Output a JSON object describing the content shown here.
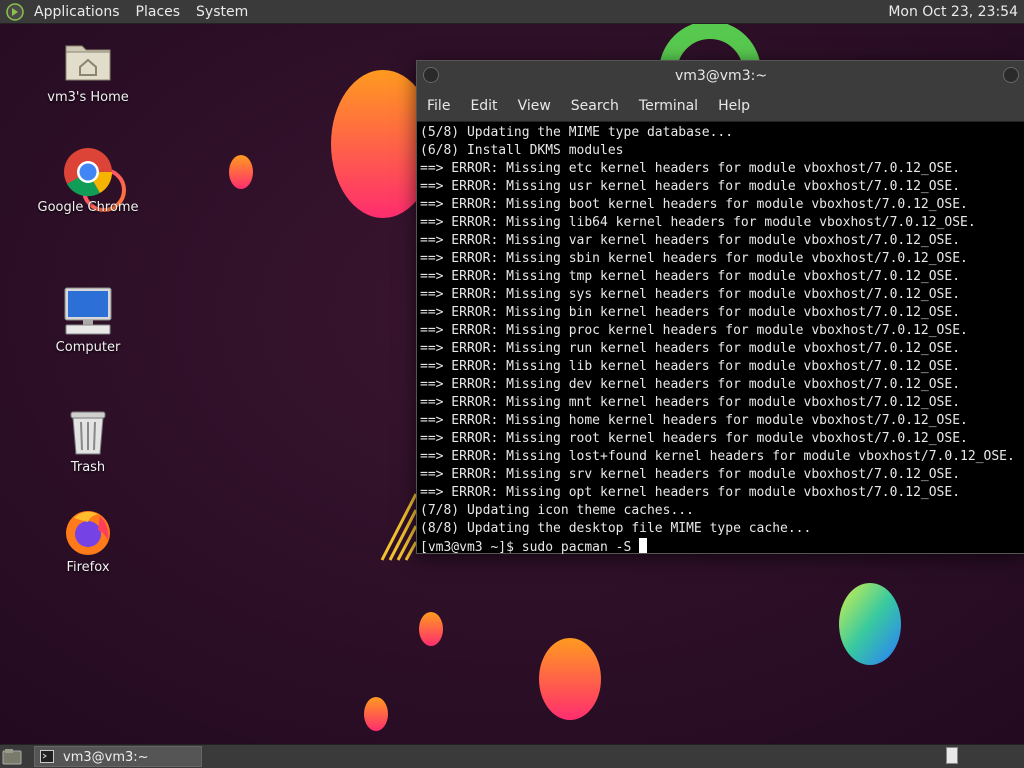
{
  "top_panel": {
    "menus": [
      "Applications",
      "Places",
      "System"
    ],
    "clock": "Mon Oct 23, 23:54"
  },
  "desktop_icons": [
    {
      "label": "vm3's Home",
      "icon": "home-folder-icon"
    },
    {
      "label": "Google Chrome",
      "icon": "chrome-icon"
    },
    {
      "label": "Computer",
      "icon": "computer-icon"
    },
    {
      "label": "Trash",
      "icon": "trash-icon"
    },
    {
      "label": "Firefox",
      "icon": "firefox-icon"
    }
  ],
  "terminal": {
    "title": "vm3@vm3:~",
    "menus": [
      "File",
      "Edit",
      "View",
      "Search",
      "Terminal",
      "Help"
    ],
    "lines": [
      "(5/8) Updating the MIME type database...",
      "(6/8) Install DKMS modules",
      "==> ERROR: Missing etc kernel headers for module vboxhost/7.0.12_OSE.",
      "==> ERROR: Missing usr kernel headers for module vboxhost/7.0.12_OSE.",
      "==> ERROR: Missing boot kernel headers for module vboxhost/7.0.12_OSE.",
      "==> ERROR: Missing lib64 kernel headers for module vboxhost/7.0.12_OSE.",
      "==> ERROR: Missing var kernel headers for module vboxhost/7.0.12_OSE.",
      "==> ERROR: Missing sbin kernel headers for module vboxhost/7.0.12_OSE.",
      "==> ERROR: Missing tmp kernel headers for module vboxhost/7.0.12_OSE.",
      "==> ERROR: Missing sys kernel headers for module vboxhost/7.0.12_OSE.",
      "==> ERROR: Missing bin kernel headers for module vboxhost/7.0.12_OSE.",
      "==> ERROR: Missing proc kernel headers for module vboxhost/7.0.12_OSE.",
      "==> ERROR: Missing run kernel headers for module vboxhost/7.0.12_OSE.",
      "==> ERROR: Missing lib kernel headers for module vboxhost/7.0.12_OSE.",
      "==> ERROR: Missing dev kernel headers for module vboxhost/7.0.12_OSE.",
      "==> ERROR: Missing mnt kernel headers for module vboxhost/7.0.12_OSE.",
      "==> ERROR: Missing home kernel headers for module vboxhost/7.0.12_OSE.",
      "==> ERROR: Missing root kernel headers for module vboxhost/7.0.12_OSE.",
      "==> ERROR: Missing lost+found kernel headers for module vboxhost/7.0.12_OSE.",
      "==> ERROR: Missing srv kernel headers for module vboxhost/7.0.12_OSE.",
      "==> ERROR: Missing opt kernel headers for module vboxhost/7.0.12_OSE.",
      "(7/8) Updating icon theme caches...",
      "(8/8) Updating the desktop file MIME type cache..."
    ],
    "prompt": "[vm3@vm3 ~]$ sudo pacman -S "
  },
  "bottom_panel": {
    "task_label": "vm3@vm3:~"
  },
  "colors": {
    "panel": "#3a3a3a",
    "wallpaper": "#2a1026",
    "terminal_bg": "#000000",
    "terminal_fg": "#e8e8e8"
  }
}
